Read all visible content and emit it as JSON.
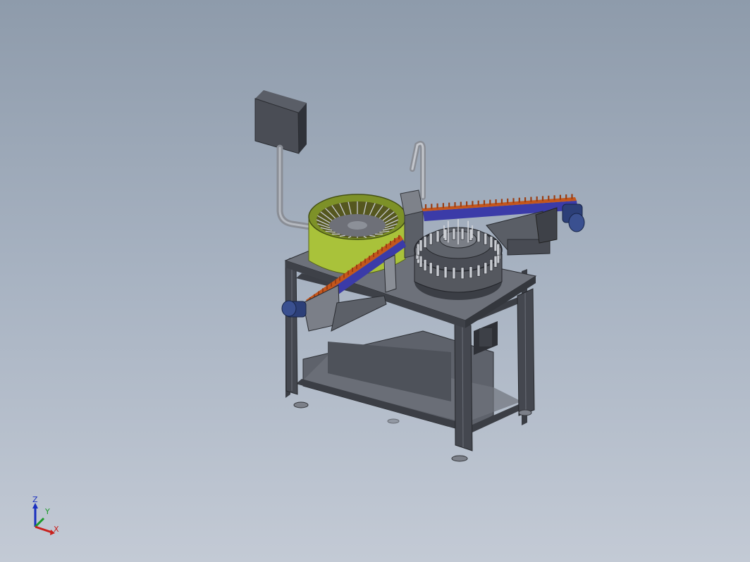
{
  "triad": {
    "z_label": "Z",
    "y_label": "Y",
    "x_label": "X",
    "colors": {
      "z": "#1a2fbf",
      "y": "#1c9a2a",
      "x": "#c8201c"
    }
  },
  "model": {
    "colors": {
      "frame": "#3d4048",
      "frame_light": "#5c616b",
      "bowl": "#a9c23a",
      "bowl_dark": "#6f8324",
      "conveyor_parts": "#c4561c",
      "conveyor_bed": "#3b3ba8",
      "motor": "#2c3f78",
      "panel": "#4a4d55",
      "table_top": "#6d717a"
    }
  }
}
